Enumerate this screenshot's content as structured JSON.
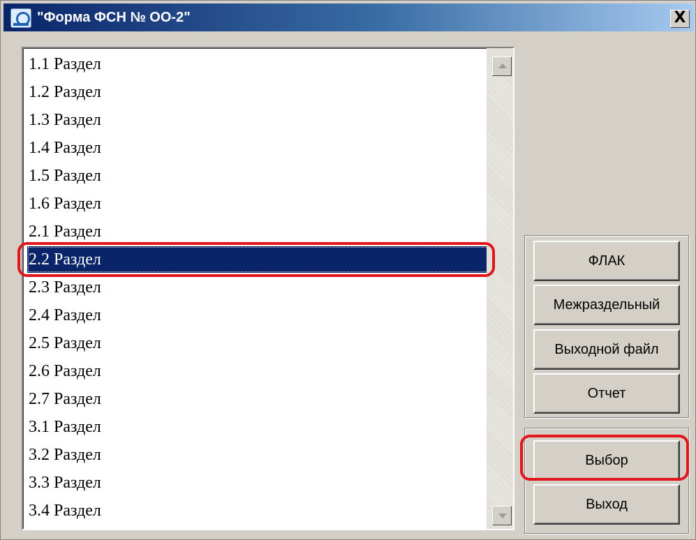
{
  "window": {
    "title": "\"Форма ФСН № ОО-2\"",
    "close_label": "X",
    "icon": "app-logo-icon"
  },
  "sections": {
    "items": [
      "1.1 Раздел",
      "1.2 Раздел",
      "1.3 Раздел",
      "1.4 Раздел",
      "1.5 Раздел",
      "1.6 Раздел",
      "2.1 Раздел",
      "2.2 Раздел",
      "2.3 Раздел",
      "2.4 Раздел",
      "2.5 Раздел",
      "2.6 Раздел",
      "2.7 Раздел",
      "3.1 Раздел",
      "3.2 Раздел",
      "3.3 Раздел",
      "3.4 Раздел"
    ],
    "selected": "2.2 Раздел"
  },
  "actions": {
    "flak": "ФЛАК",
    "interdepartmental": "Межраздельный",
    "output_file": "Выходной файл",
    "report": "Отчет"
  },
  "dialog": {
    "select": "Выбор",
    "exit": "Выход"
  },
  "colors": {
    "selection": "#0a246a",
    "highlight": "#e4141b",
    "face": "#d4d0c8"
  }
}
